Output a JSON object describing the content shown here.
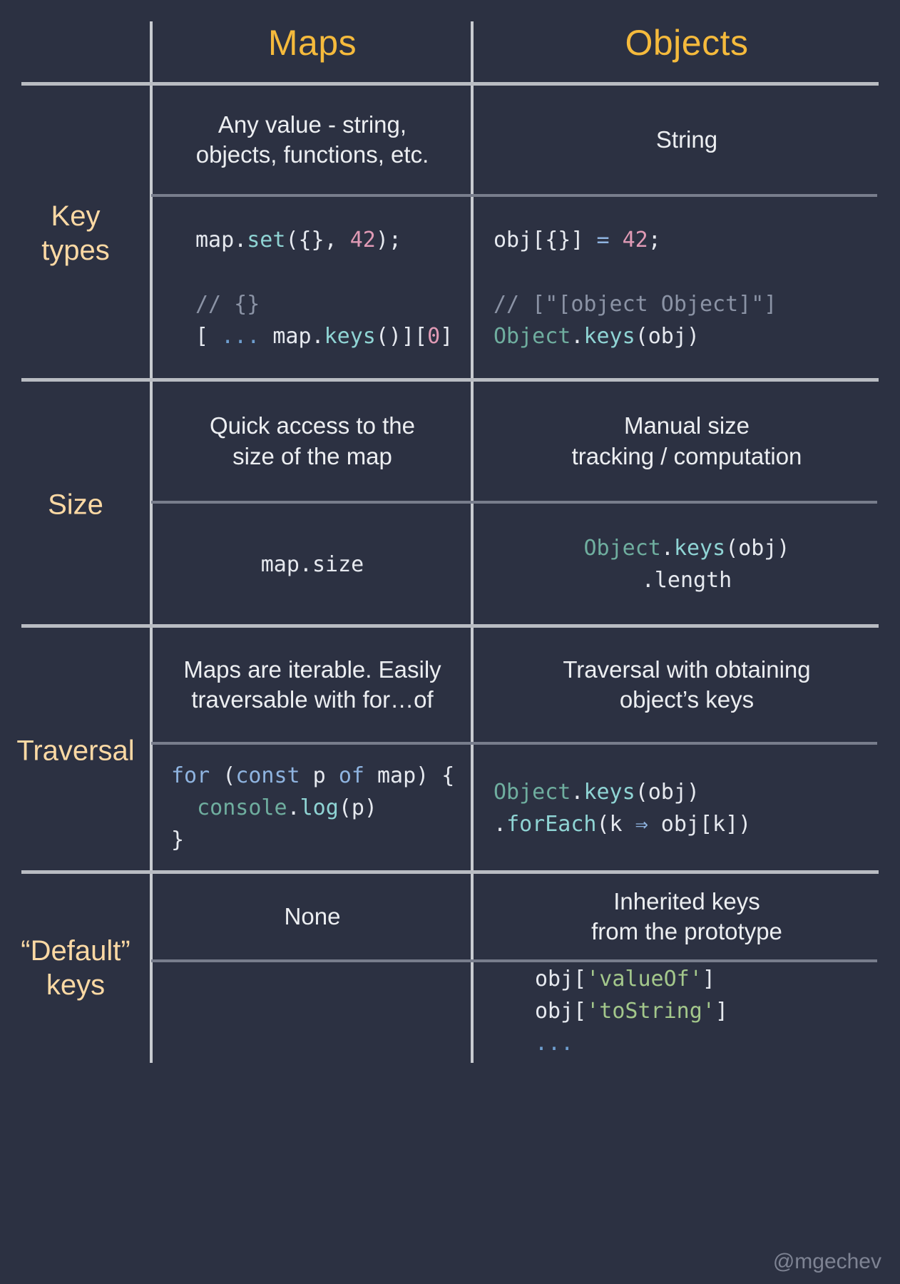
{
  "header": {
    "label_col": "",
    "maps": "Maps",
    "objects": "Objects"
  },
  "colors": {
    "background": "#2c3142",
    "header_accent": "#f5ba3c",
    "row_label_accent": "#fcd9a4",
    "rule_heavy": "#b9bcc2",
    "rule_inner": "#787d8c",
    "vertical_rule": "#c8cbd0",
    "text": "#eceef1",
    "code_plain": "#e6e9ef",
    "code_function": "#8fd4d4",
    "code_object": "#6fae9f",
    "code_number": "#e09ab5",
    "code_comment": "#8b93a5",
    "code_keyword": "#8fb4e0",
    "code_string": "#a3c78b",
    "code_ellipsis": "#6f9fd0",
    "watermark": "#7e8393"
  },
  "rows": [
    {
      "label": "Key\ntypes",
      "maps_prose": "Any value - string,\nobjects, functions, etc.",
      "objects_prose": "String",
      "maps_code": [
        {
          "text": "map.",
          "cls": "c-plain"
        },
        {
          "text": "set",
          "cls": "c-fn"
        },
        {
          "text": "({}, ",
          "cls": "c-plain"
        },
        {
          "text": "42",
          "cls": "c-num"
        },
        {
          "text": ");",
          "cls": "c-plain"
        },
        {
          "text": "\n\n",
          "cls": "c-plain"
        },
        {
          "text": "// {}",
          "cls": "c-cmt"
        },
        {
          "text": "\n",
          "cls": "c-plain"
        },
        {
          "text": "[ ",
          "cls": "c-plain"
        },
        {
          "text": "...",
          "cls": "c-dots"
        },
        {
          "text": " map.",
          "cls": "c-plain"
        },
        {
          "text": "keys",
          "cls": "c-fn"
        },
        {
          "text": "()][",
          "cls": "c-plain"
        },
        {
          "text": "0",
          "cls": "c-num"
        },
        {
          "text": "]",
          "cls": "c-plain"
        }
      ],
      "objects_code": [
        {
          "text": "obj[{}] ",
          "cls": "c-plain"
        },
        {
          "text": "=",
          "cls": "c-op"
        },
        {
          "text": " ",
          "cls": "c-plain"
        },
        {
          "text": "42",
          "cls": "c-num"
        },
        {
          "text": ";",
          "cls": "c-plain"
        },
        {
          "text": "\n\n",
          "cls": "c-plain"
        },
        {
          "text": "// [\"[object Object]\"]",
          "cls": "c-cmt"
        },
        {
          "text": "\n",
          "cls": "c-plain"
        },
        {
          "text": "Object",
          "cls": "c-obj"
        },
        {
          "text": ".",
          "cls": "c-plain"
        },
        {
          "text": "keys",
          "cls": "c-fn"
        },
        {
          "text": "(obj)",
          "cls": "c-plain"
        }
      ]
    },
    {
      "label": "Size",
      "maps_prose": "Quick access to the\nsize of the map",
      "objects_prose": "Manual size\ntracking / computation",
      "maps_code": [
        {
          "text": "map.size",
          "cls": "c-plain"
        }
      ],
      "objects_code": [
        {
          "text": "Object",
          "cls": "c-obj"
        },
        {
          "text": ".",
          "cls": "c-plain"
        },
        {
          "text": "keys",
          "cls": "c-fn"
        },
        {
          "text": "(obj)",
          "cls": "c-plain"
        },
        {
          "text": "\n",
          "cls": "c-plain"
        },
        {
          "text": ".length",
          "cls": "c-plain"
        }
      ]
    },
    {
      "label": "Traversal",
      "maps_prose": "Maps are iterable. Easily\ntraversable with for…of",
      "objects_prose": "Traversal with obtaining\nobject’s keys",
      "maps_code": [
        {
          "text": "for",
          "cls": "c-kw"
        },
        {
          "text": " (",
          "cls": "c-plain"
        },
        {
          "text": "const",
          "cls": "c-kw"
        },
        {
          "text": " p ",
          "cls": "c-plain"
        },
        {
          "text": "of",
          "cls": "c-kw"
        },
        {
          "text": " map) {",
          "cls": "c-plain"
        },
        {
          "text": "\n  ",
          "cls": "c-plain"
        },
        {
          "text": "console",
          "cls": "c-obj"
        },
        {
          "text": ".",
          "cls": "c-plain"
        },
        {
          "text": "log",
          "cls": "c-fn"
        },
        {
          "text": "(p)",
          "cls": "c-plain"
        },
        {
          "text": "\n}",
          "cls": "c-plain"
        }
      ],
      "objects_code": [
        {
          "text": "Object",
          "cls": "c-obj"
        },
        {
          "text": ".",
          "cls": "c-plain"
        },
        {
          "text": "keys",
          "cls": "c-fn"
        },
        {
          "text": "(obj)",
          "cls": "c-plain"
        },
        {
          "text": "\n.",
          "cls": "c-plain"
        },
        {
          "text": "forEach",
          "cls": "c-fn"
        },
        {
          "text": "(k ",
          "cls": "c-plain"
        },
        {
          "text": "⇒",
          "cls": "c-op"
        },
        {
          "text": " obj[k])",
          "cls": "c-plain"
        }
      ]
    },
    {
      "label": "“Default”\nkeys",
      "maps_prose": "None",
      "objects_prose": "Inherited keys\nfrom the prototype",
      "maps_code": [],
      "objects_code": [
        {
          "text": "obj[",
          "cls": "c-plain"
        },
        {
          "text": "'valueOf'",
          "cls": "c-str"
        },
        {
          "text": "]",
          "cls": "c-plain"
        },
        {
          "text": "\n",
          "cls": "c-plain"
        },
        {
          "text": "obj[",
          "cls": "c-plain"
        },
        {
          "text": "'toString'",
          "cls": "c-str"
        },
        {
          "text": "]",
          "cls": "c-plain"
        },
        {
          "text": "\n",
          "cls": "c-plain"
        },
        {
          "text": "...",
          "cls": "c-dots"
        }
      ]
    }
  ],
  "watermark": "@mgechev"
}
